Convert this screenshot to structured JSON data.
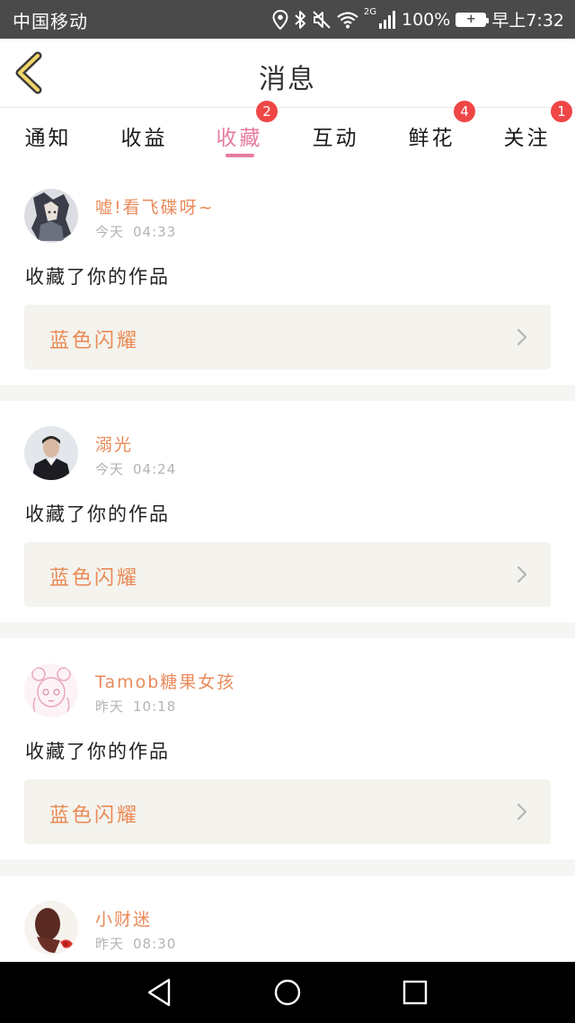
{
  "status_bar": {
    "carrier": "中国移动",
    "network": "2G",
    "battery_percent": "100%",
    "time": "早上7:32"
  },
  "header": {
    "title": "消息"
  },
  "tabs": [
    {
      "label": "通知",
      "badge": null,
      "active": false
    },
    {
      "label": "收益",
      "badge": null,
      "active": false
    },
    {
      "label": "收藏",
      "badge": "2",
      "active": true
    },
    {
      "label": "互动",
      "badge": null,
      "active": false
    },
    {
      "label": "鲜花",
      "badge": "4",
      "active": false
    },
    {
      "label": "关注",
      "badge": "1",
      "active": false
    }
  ],
  "feed": [
    {
      "name": "嘘!看飞碟呀~",
      "day": "今天",
      "time": "04:33",
      "message": "收藏了你的作品",
      "work": "蓝色闪耀"
    },
    {
      "name": "溺光",
      "day": "今天",
      "time": "04:24",
      "message": "收藏了你的作品",
      "work": "蓝色闪耀"
    },
    {
      "name": "Tamob糖果女孩",
      "day": "昨天",
      "time": "10:18",
      "message": "收藏了你的作品",
      "work": "蓝色闪耀"
    },
    {
      "name": "小财迷",
      "day": "昨天",
      "time": "08:30"
    }
  ],
  "colors": {
    "accent_pink": "#e57c9d",
    "name_orange": "#e98a5a",
    "badge_red": "#f04646",
    "status_bar_bg": "#4a4a4a"
  },
  "icons": {
    "back": "chevron-left-icon",
    "location": "location-icon",
    "bluetooth": "bluetooth-icon",
    "mute": "mute-icon",
    "wifi": "wifi-icon",
    "signal": "signal-icon",
    "battery": "battery-icon",
    "work_chevron": "chevron-right-icon",
    "nav_back": "nav-back-icon",
    "nav_home": "nav-home-icon",
    "nav_recents": "nav-recents-icon"
  }
}
